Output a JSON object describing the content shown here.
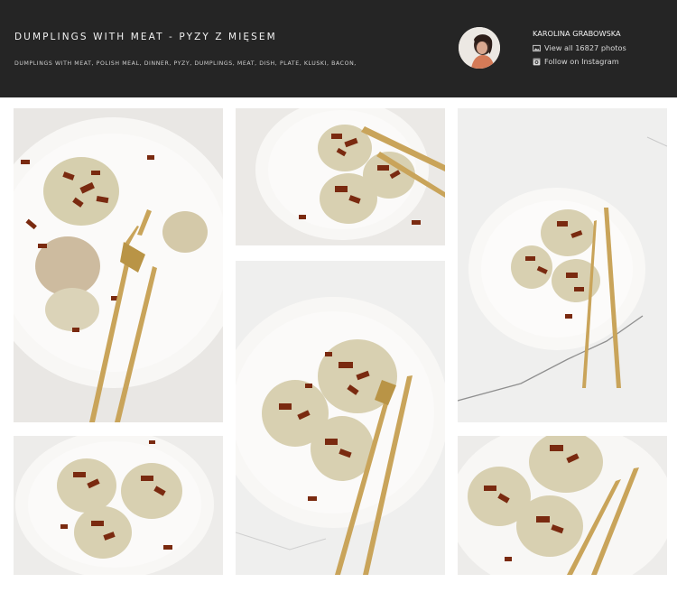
{
  "header": {
    "title": "DUMPLINGS WITH MEAT - PYZY Z MIĘSEM",
    "tags": "DUMPLINGS WITH MEAT, POLISH MEAL, DINNER, PYZY, DUMPLINGS, MEAT, DISH, PLATE, KLUSKI, BACON,",
    "author_name": "KAROLINA GRABOWSKA",
    "view_all_label": "View all 16827 photos",
    "follow_label": "Follow on Instagram"
  },
  "icons": {
    "photos": "image-icon",
    "instagram": "instagram-icon"
  },
  "colors": {
    "header_bg": "#252525",
    "plate": "#f7f6f4",
    "dumpling": "#d8d2b4",
    "bacon": "#7a2a10",
    "cutlery": "#c9a45a"
  },
  "gallery": {
    "photos": [
      {
        "id": "photo-1",
        "subject": "plate with cut dumplings and gold fork"
      },
      {
        "id": "photo-2",
        "subject": "three dumplings with bacon and gold cutlery"
      },
      {
        "id": "photo-3",
        "subject": "plate of dumplings on marble"
      },
      {
        "id": "photo-4",
        "subject": "dumplings on plate with fork and knife"
      },
      {
        "id": "photo-5",
        "subject": "three dumplings topped with bacon"
      },
      {
        "id": "photo-6",
        "subject": "close-up dumplings with gold cutlery"
      }
    ]
  }
}
